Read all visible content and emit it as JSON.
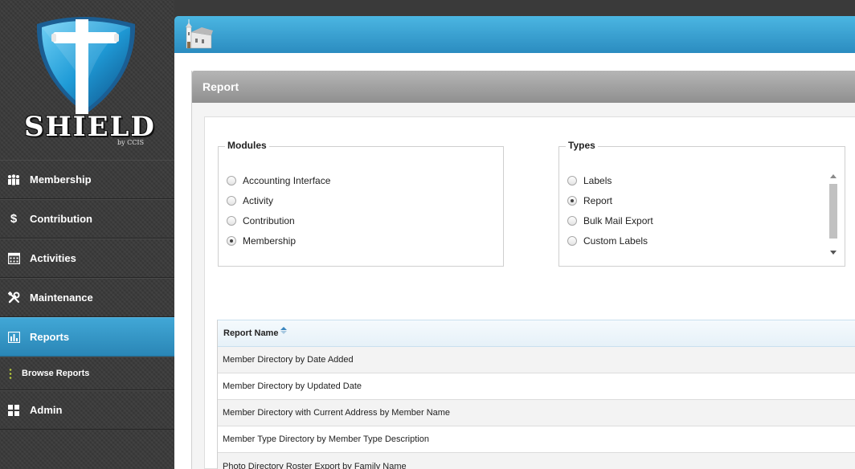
{
  "logo": {
    "word": "SHIELD",
    "sub": "by CCIS"
  },
  "nav": {
    "items": [
      {
        "label": "Membership",
        "icon": "people-icon"
      },
      {
        "label": "Contribution",
        "icon": "dollar-icon"
      },
      {
        "label": "Activities",
        "icon": "calendar-icon"
      },
      {
        "label": "Maintenance",
        "icon": "tools-icon"
      },
      {
        "label": "Reports",
        "icon": "bar-chart-icon",
        "active": true
      }
    ],
    "sub_item": {
      "label": "Browse Reports"
    },
    "admin": {
      "label": "Admin",
      "icon": "grid-icon"
    }
  },
  "panel": {
    "title": "Report"
  },
  "modules": {
    "legend": "Modules",
    "options": [
      "Accounting Interface",
      "Activity",
      "Contribution",
      "Membership"
    ],
    "selected": "Membership"
  },
  "types": {
    "legend": "Types",
    "options": [
      "Labels",
      "Report",
      "Bulk Mail Export",
      "Custom Labels"
    ],
    "selected": "Report"
  },
  "grid": {
    "column_header": "Report Name",
    "rows": [
      "Member Directory by Date Added",
      "Member Directory by Updated Date",
      "Member Directory with Current Address by Member Name",
      "Member Type Directory by Member Type Description",
      "Photo Directory Roster Export by Family Name"
    ]
  },
  "colors": {
    "accent": "#2a86b6",
    "sidebar": "#3b3b3b"
  }
}
